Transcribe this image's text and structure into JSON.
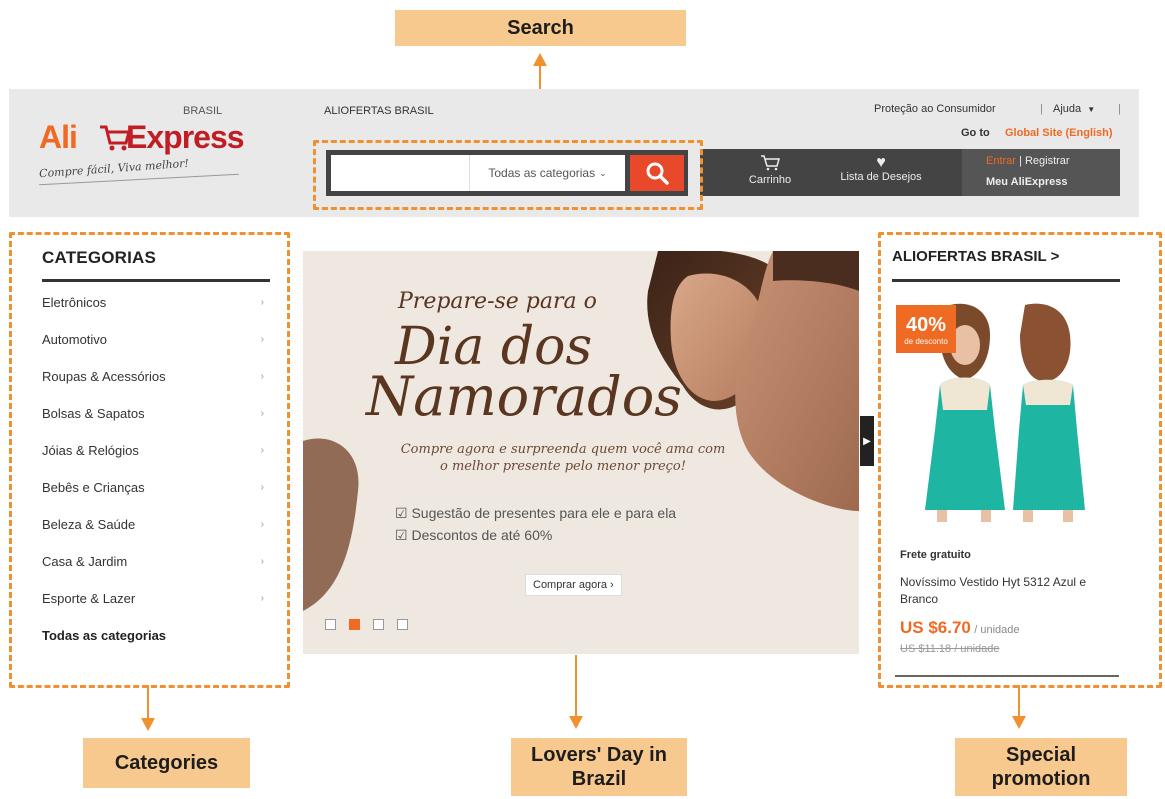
{
  "annotations": {
    "search": "Search",
    "categories": "Categories",
    "lovers": "Lovers' Day in Brazil",
    "promotion": "Special promotion"
  },
  "header": {
    "logo_ali": "Ali",
    "logo_express": "Express",
    "logo_country": "BRASIL",
    "tagline": "Compre fácil, Viva melhor!",
    "top_center_link": "ALIOFERTAS BRASIL",
    "consumer_protection": "Proteção ao Consumidor",
    "help": "Ajuda",
    "goto_prefix": "Go to",
    "global_site": "Global Site (English)",
    "search_placeholder": "",
    "search_category": "Todas as categorias",
    "cart": "Carrinho",
    "wishlist": "Lista de Desejos",
    "signin": "Entrar",
    "register": "Registrar",
    "my_account": "Meu AliExpress"
  },
  "categories": {
    "title": "CATEGORIAS",
    "items": [
      "Eletrônicos",
      "Automotivo",
      "Roupas & Acessórios",
      "Bolsas & Sapatos",
      "Jóias & Relógios",
      "Bebês e Crianças",
      "Beleza & Saúde",
      "Casa & Jardim",
      "Esporte & Lazer"
    ],
    "all": "Todas as categorias"
  },
  "banner": {
    "pre": "Prepare-se para o",
    "title1": "Dia dos",
    "title2": "Namorados",
    "subtitle": "Compre agora e surpreenda quem você ama com o melhor presente pelo menor preço!",
    "bullet1": "Sugestão de presentes para ele e para ela",
    "bullet2": "Descontos de até 60%",
    "cta": "Comprar agora ›",
    "active_slide": 2,
    "slide_count": 4
  },
  "promotion": {
    "title": "ALIOFERTAS BRASIL >",
    "badge_percent": "40%",
    "badge_label": "de desconto",
    "shipping": "Frete gratuito",
    "product_name": "Novíssimo Vestido Hyt 5312 Azul e Branco",
    "price": "US $6.70",
    "price_unit": "/ unidade",
    "old_price": "US $11.18 / unidade"
  },
  "colors": {
    "orange": "#ef6a22",
    "red": "#c11d24",
    "search_button": "#e8492b",
    "annotation_fill": "#f8c98e",
    "annotation_border": "#f0902f",
    "dress_teal": "#1fb5a3"
  }
}
